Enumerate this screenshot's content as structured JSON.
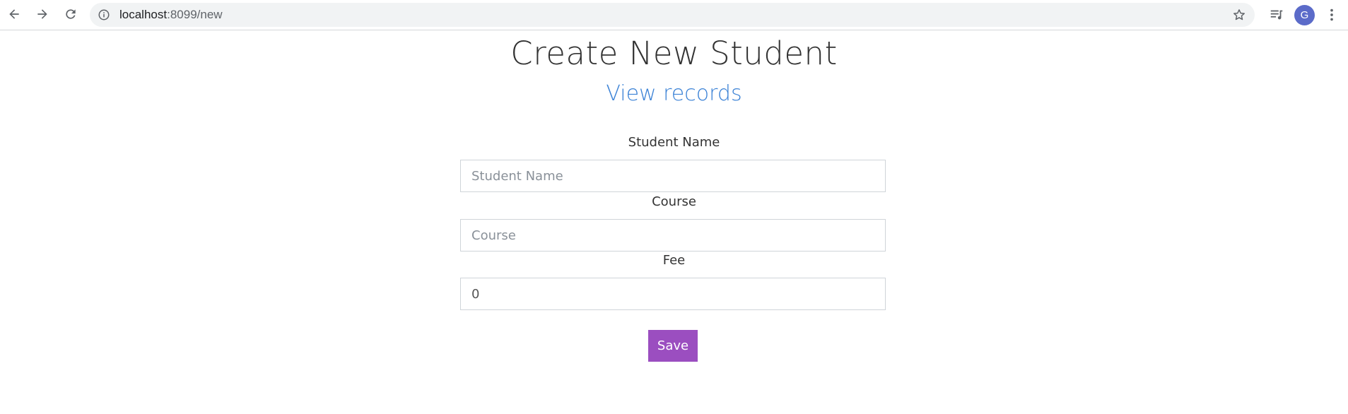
{
  "browser": {
    "url_host": "localhost",
    "url_path": ":8099/new",
    "profile_initial": "G",
    "icons": {
      "back": "arrow-left-icon",
      "forward": "arrow-right-icon",
      "reload": "reload-icon",
      "site_info": "info-icon",
      "bookmark": "star-icon",
      "media": "media-playlist-icon",
      "menu": "kebab-menu-icon"
    },
    "avatar_color": "#5b6bc9"
  },
  "page": {
    "title": "Create New Student",
    "view_records_link": "View records",
    "link_color": "#3b82d6"
  },
  "form": {
    "student_name": {
      "label": "Student Name",
      "placeholder": "Student Name",
      "value": ""
    },
    "course": {
      "label": "Course",
      "placeholder": "Course",
      "value": ""
    },
    "fee": {
      "label": "Fee",
      "placeholder": "",
      "value": "0"
    },
    "save_label": "Save",
    "save_color": "#9b4ec0"
  }
}
